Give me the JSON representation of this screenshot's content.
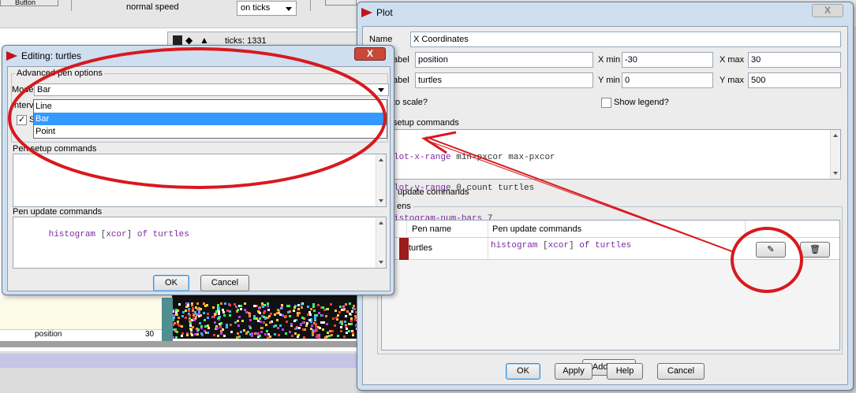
{
  "background": {
    "top_button_label": "Button",
    "speed_label": "normal speed",
    "update_mode_value": "on ticks",
    "ticks_label": "ticks: 1331",
    "plot_axis_label": "position",
    "plot_axis_max": "30"
  },
  "pen_dialog": {
    "title": "Editing: turtles",
    "group_label": "Advanced pen options",
    "mode_label": "Mode",
    "mode_value": "Bar",
    "mode_options": [
      "Line",
      "Bar",
      "Point"
    ],
    "mode_selected_index": 1,
    "interval_label": "Interv",
    "show_label": "S",
    "setup_label": "Pen setup commands",
    "setup_code": "",
    "update_label": "Pen update commands",
    "update_code_parts": [
      "histogram",
      " [",
      "xcor",
      "] ",
      "of",
      " ",
      "turtles"
    ],
    "ok_label": "OK",
    "cancel_label": "Cancel",
    "close_glyph": "X"
  },
  "plot_dialog": {
    "title": "Plot",
    "name_label": "Name",
    "name_value": "X Coordinates",
    "x_axis_label": "abel",
    "x_axis_value": "position",
    "x_min_label": "X min",
    "x_min_value": "-30",
    "x_max_label": "X max",
    "x_max_value": "30",
    "y_axis_label": "abel",
    "y_axis_value": "turtles",
    "y_min_label": "Y min",
    "y_min_value": "0",
    "y_max_label": "Y max",
    "y_max_value": "500",
    "autoscale_label": "to scale?",
    "show_legend_label": "Show legend?",
    "setup_label": "setup commands",
    "setup_lines": [
      [
        "lot-x-range",
        " min-pxcor max-pxcor"
      ],
      [
        "lot-y-range",
        " 0 count turtles"
      ],
      [
        "istogram-num-bars",
        " 7"
      ]
    ],
    "update_label": "update commands",
    "pens_label": "ens",
    "pens_col_name": "Pen name",
    "pens_col_update": "Pen update commands",
    "pen_rows": [
      {
        "name": "turtles",
        "color": "#9b1c1c",
        "update": "histogram [xcor] of turtles"
      }
    ],
    "add_pen_label": "Add Pen",
    "ok_label": "OK",
    "apply_label": "Apply",
    "help_label": "Help",
    "cancel_label": "Cancel",
    "close_glyph": "X"
  }
}
